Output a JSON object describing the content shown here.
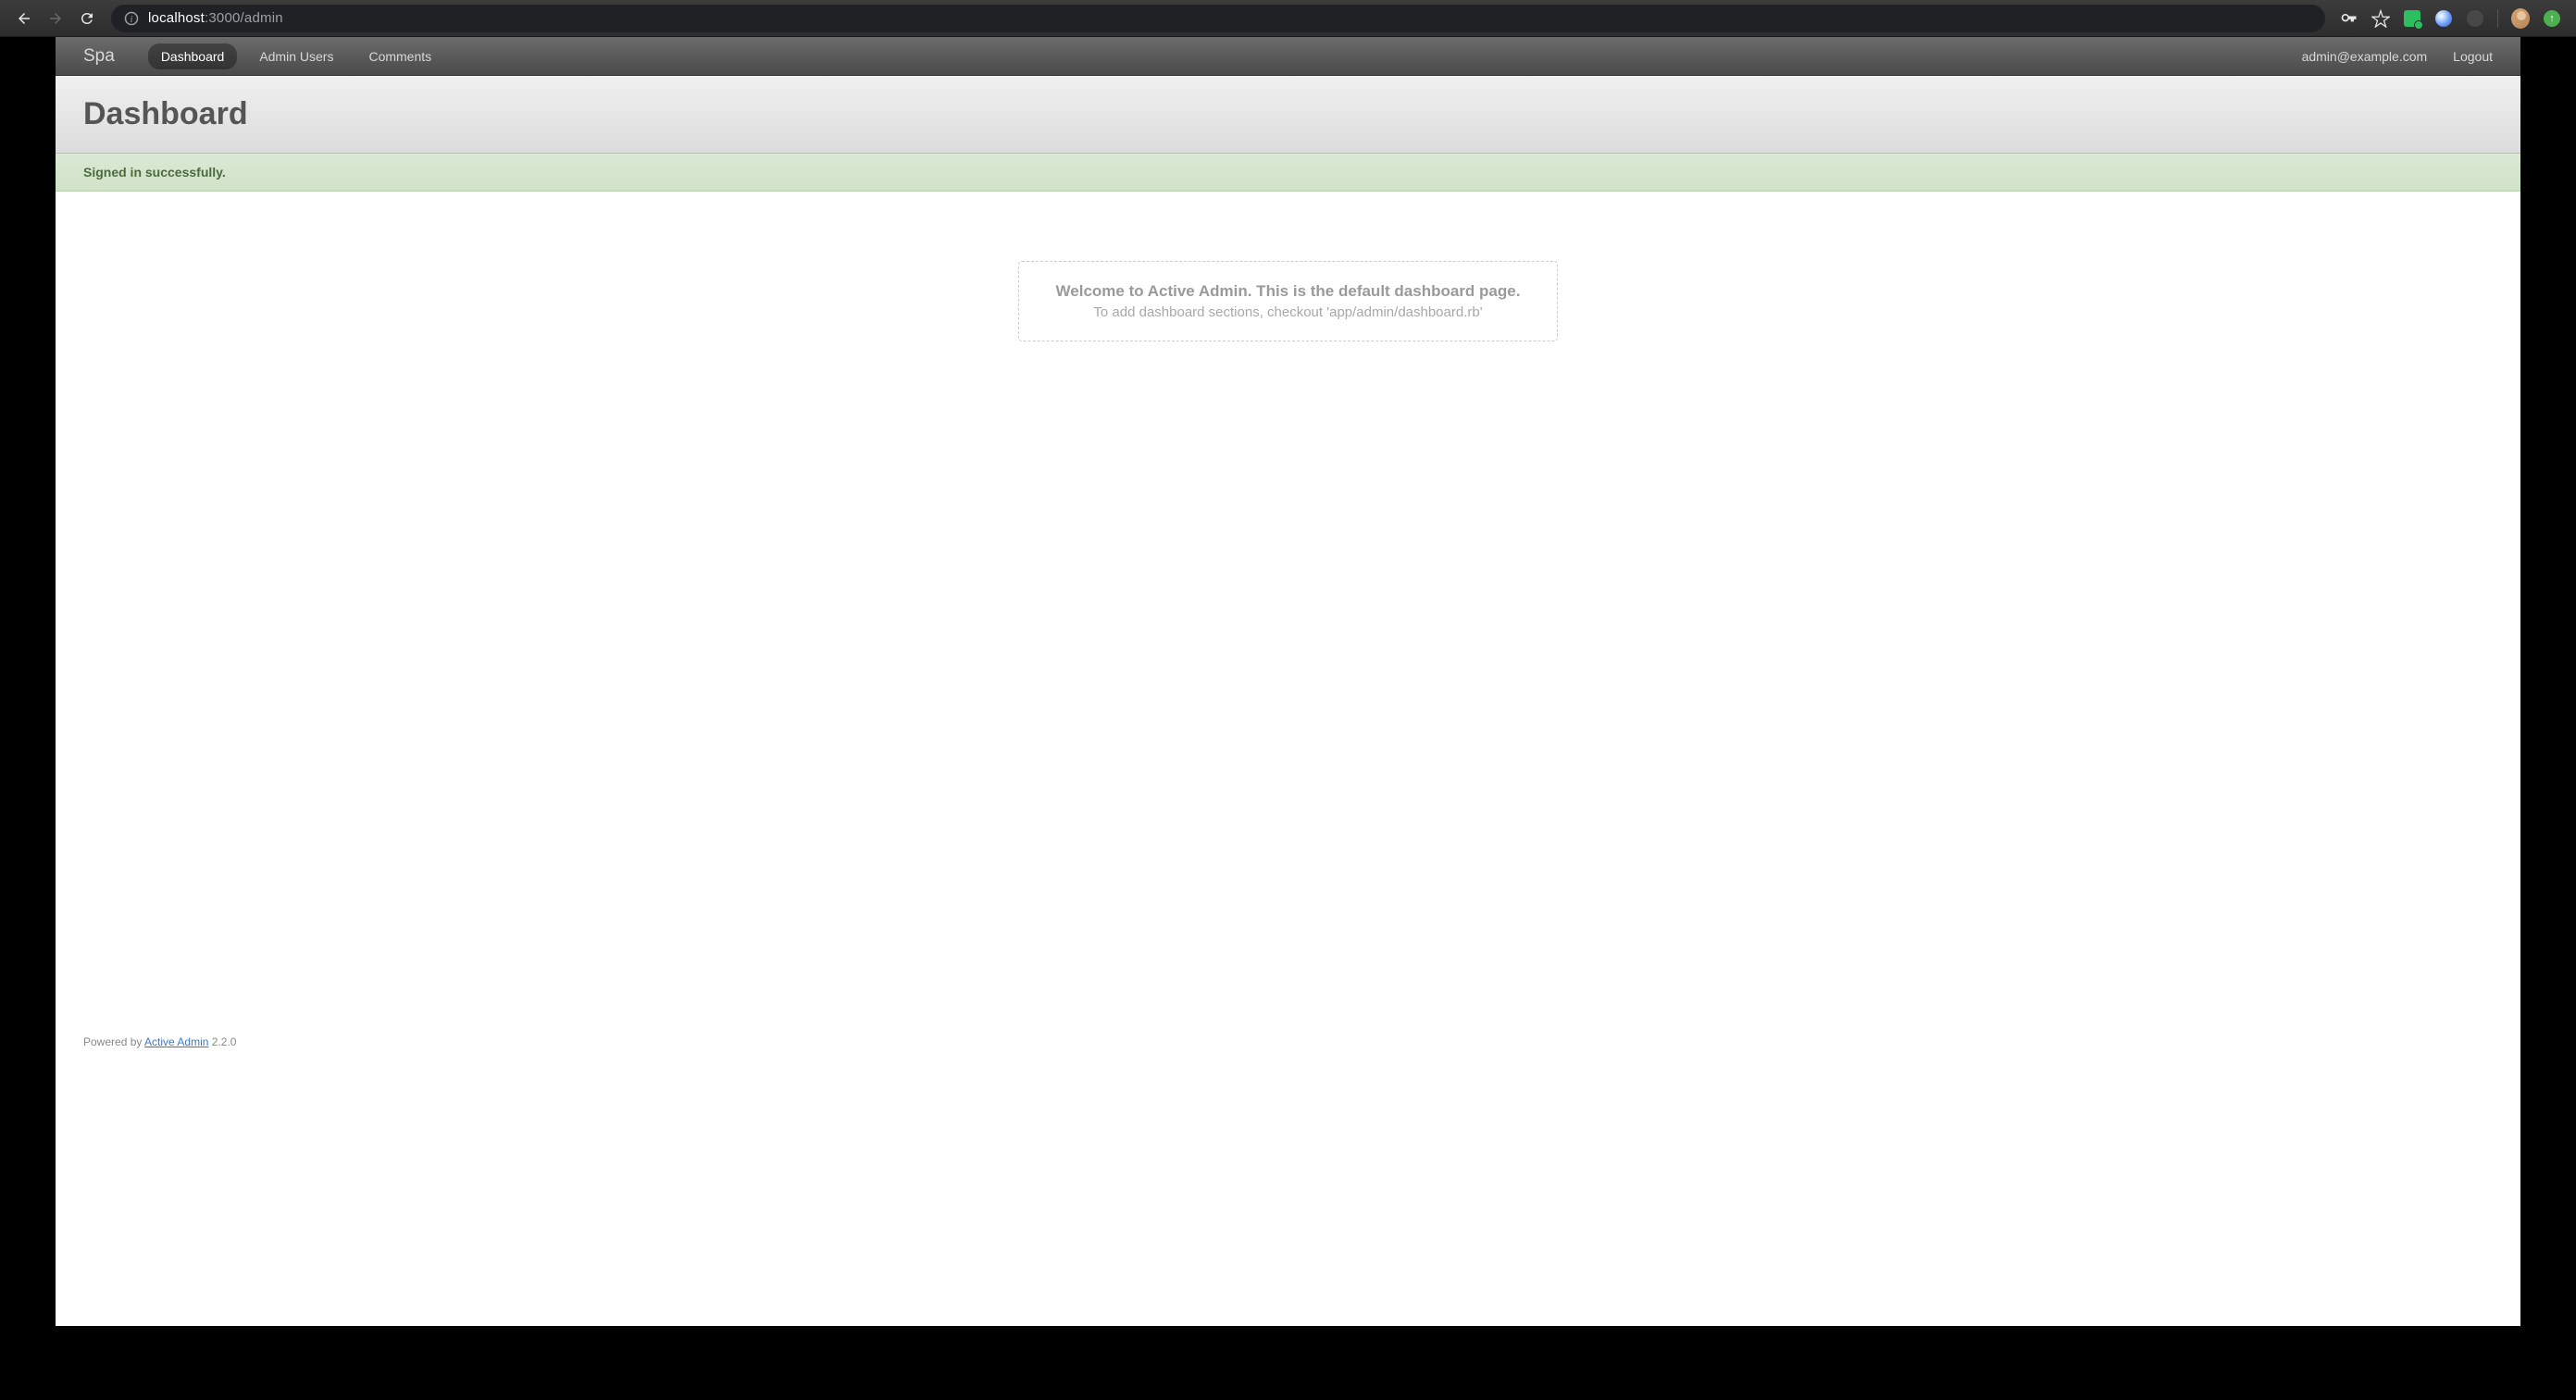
{
  "browser": {
    "url_prefix": "localhost",
    "url_suffix": ":3000/admin"
  },
  "nav": {
    "site_title": "Spa",
    "items": [
      {
        "label": "Dashboard",
        "active": true
      },
      {
        "label": "Admin Users",
        "active": false
      },
      {
        "label": "Comments",
        "active": false
      }
    ],
    "user_email": "admin@example.com",
    "logout_label": "Logout"
  },
  "page_title": "Dashboard",
  "flash": {
    "message": "Signed in successfully."
  },
  "welcome": {
    "title": "Welcome to Active Admin. This is the default dashboard page.",
    "subtitle": "To add dashboard sections, checkout 'app/admin/dashboard.rb'"
  },
  "footer": {
    "powered_by": "Powered by ",
    "link_text": "Active Admin",
    "version": " 2.2.0"
  }
}
